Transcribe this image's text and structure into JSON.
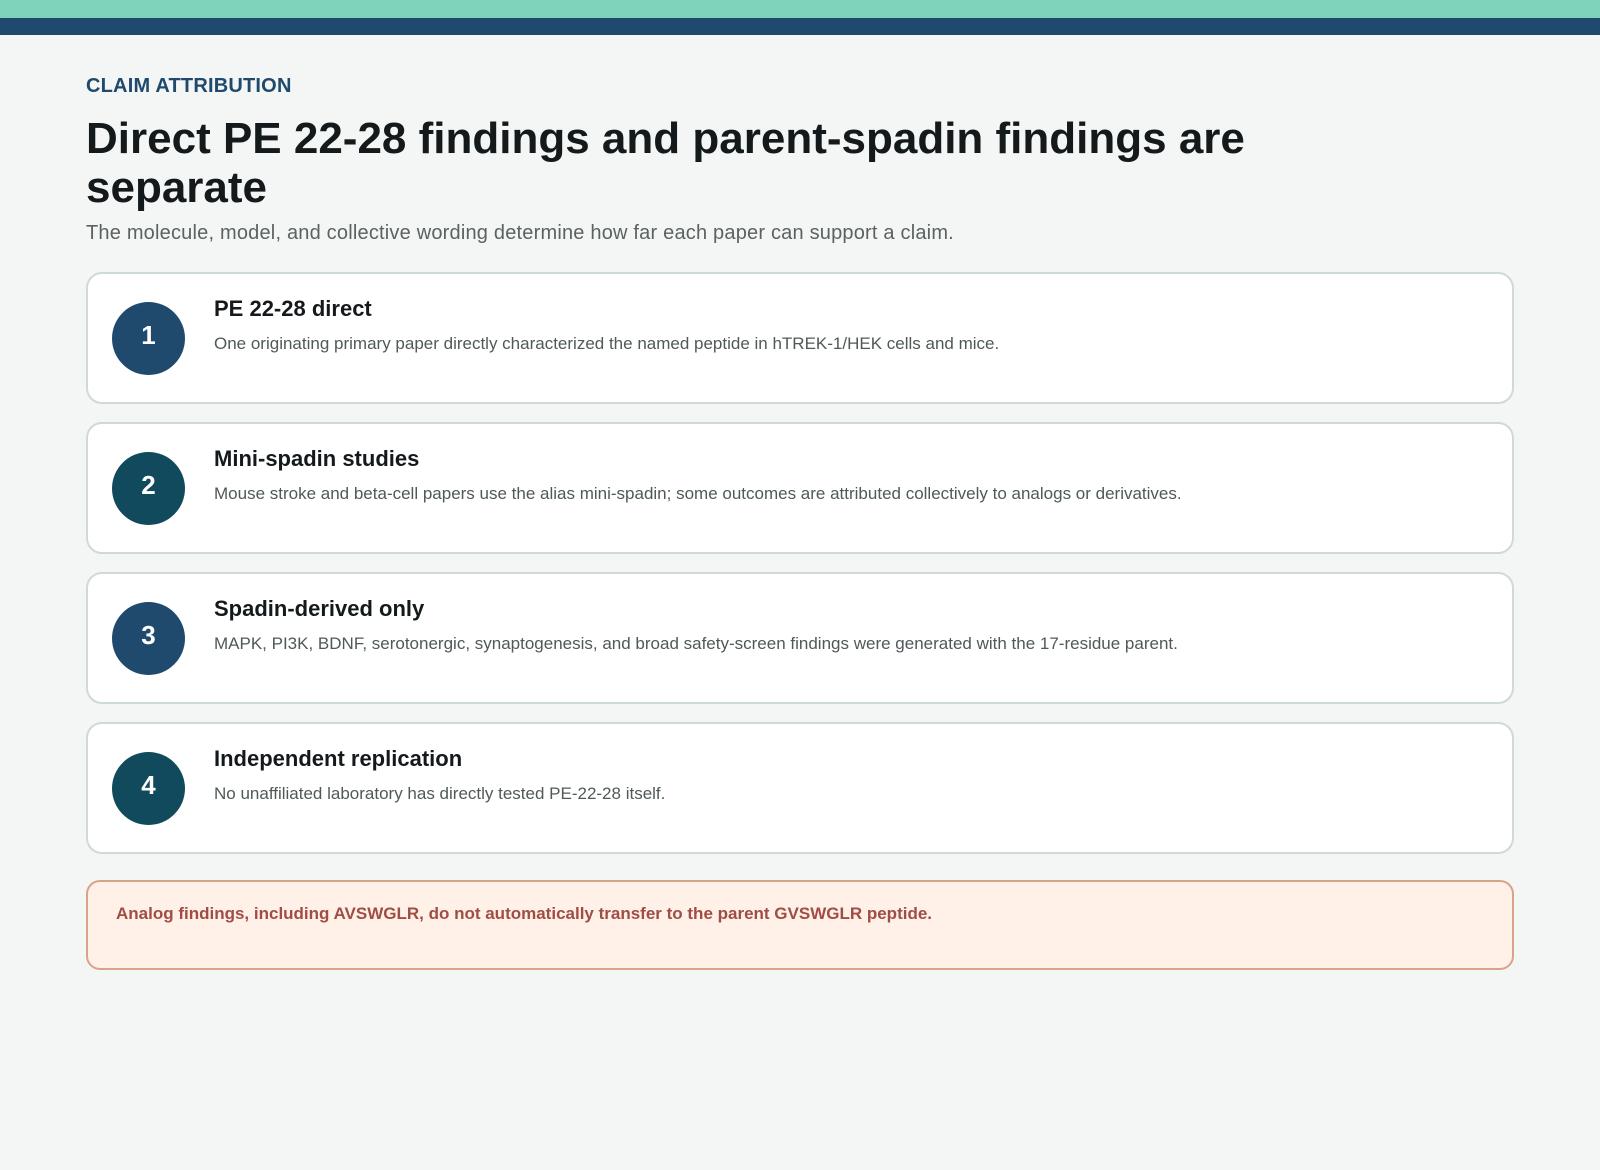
{
  "colors": {
    "band_top": "#7ed3ba",
    "band_bottom": "#204a6d",
    "badge_blue": "#204a6d",
    "badge_teal": "#114a5c",
    "notice_bg": "#fff0e8",
    "notice_text": "#a04d43"
  },
  "header": {
    "eyebrow": "CLAIM ATTRIBUTION",
    "title": "Direct PE 22-28 findings and parent-spadin findings are separate",
    "subtitle": "The molecule, model, and collective wording determine how far each paper can support a claim."
  },
  "cards": [
    {
      "number": "1",
      "title": "PE 22-28 direct",
      "text": "One originating primary paper directly characterized the named peptide in hTREK-1/HEK cells and mice."
    },
    {
      "number": "2",
      "title": "Mini-spadin studies",
      "text": "Mouse stroke and beta-cell papers use the alias mini-spadin; some outcomes are attributed collectively to analogs or derivatives."
    },
    {
      "number": "3",
      "title": "Spadin-derived only",
      "text": "MAPK, PI3K, BDNF, serotonergic, synaptogenesis, and broad safety-screen findings were generated with the 17-residue parent."
    },
    {
      "number": "4",
      "title": "Independent replication",
      "text": "No unaffiliated laboratory has directly tested PE-22-28 itself."
    }
  ],
  "notice": {
    "text": "Analog findings, including AVSWGLR, do not automatically transfer to the parent GVSWGLR peptide."
  }
}
